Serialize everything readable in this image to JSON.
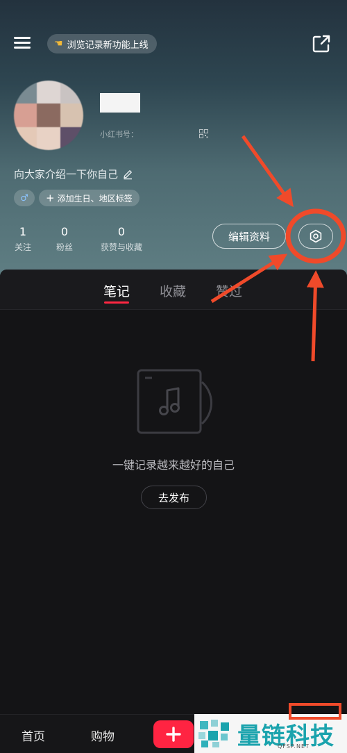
{
  "header": {
    "notice_pill": "浏览记录新功能上线",
    "rednote_id_label": "小红书号："
  },
  "profile": {
    "bio": "向大家介绍一下你自己",
    "gender_tag": "♂",
    "add_tag_label": "添加生日、地区标签",
    "edit_button": "编辑资料",
    "stats": [
      {
        "num": "1",
        "label": "关注"
      },
      {
        "num": "0",
        "label": "粉丝"
      },
      {
        "num": "0",
        "label": "获赞与收藏"
      }
    ]
  },
  "tabs": [
    {
      "label": "笔记",
      "active": true
    },
    {
      "label": "收藏",
      "active": false
    },
    {
      "label": "赞过",
      "active": false
    }
  ],
  "empty_state": {
    "text": "一键记录越来越好的自己",
    "button": "去发布"
  },
  "bottom_nav": {
    "items": [
      "首页",
      "购物"
    ]
  },
  "watermark": {
    "text": "量链科技",
    "sub": "QFSP.NET"
  },
  "colors": {
    "accent": "#ff2442",
    "annotation": "#f04a2a",
    "watermark": "#1aa3ad"
  }
}
